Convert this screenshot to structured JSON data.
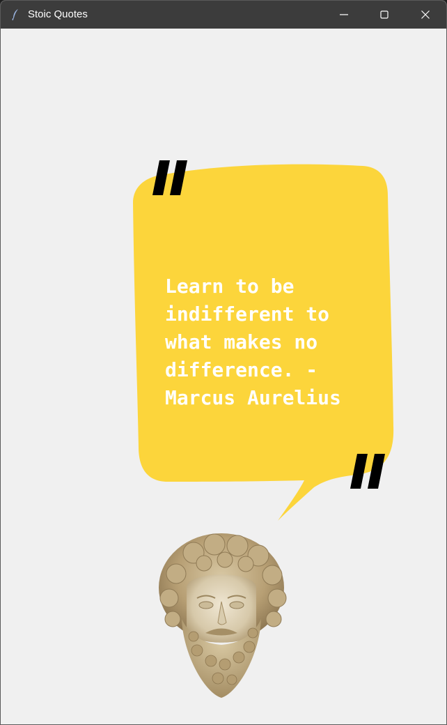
{
  "window": {
    "title": "Stoic Quotes",
    "app_icon": "feather-icon",
    "controls": {
      "minimize": "minimize-icon",
      "maximize": "maximize-icon",
      "close": "close-icon"
    }
  },
  "quote": {
    "text": "Learn to be\nindifferent to\nwhat makes no\ndifference. -\nMarcus Aurelius",
    "bubble_color": "#fcd53b",
    "text_color": "#ffffff",
    "quote_mark_color": "#000000"
  },
  "portrait": {
    "icon": "marcus-aurelius-bust-image"
  }
}
